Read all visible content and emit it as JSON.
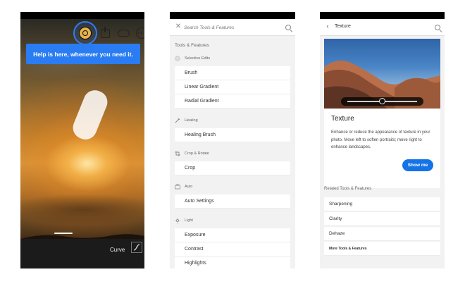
{
  "phone1": {
    "tooltip_text": "Help is here, whenever you need it.",
    "curve_label": "Curve",
    "icons": [
      "help-icon",
      "share-icon",
      "cloud-sync-icon",
      "more-icon",
      "curve-icon"
    ],
    "accent_color": "#2a7cf2"
  },
  "phone2": {
    "search_placeholder": "Search Tools & Features",
    "section_heading": "Tools & Features",
    "categories": [
      {
        "name": "Selective Edits",
        "icon": "selective-edits-icon",
        "items": [
          "Brush",
          "Linear Gradient",
          "Radial Gradient"
        ]
      },
      {
        "name": "Healing",
        "icon": "healing-icon",
        "items": [
          "Healing Brush"
        ]
      },
      {
        "name": "Crop & Rotate",
        "icon": "crop-rotate-icon",
        "items": [
          "Crop"
        ]
      },
      {
        "name": "Auto",
        "icon": "auto-icon",
        "items": [
          "Auto Settings"
        ]
      },
      {
        "name": "Light",
        "icon": "light-icon",
        "items": [
          "Exposure",
          "Contrast",
          "Highlights"
        ]
      }
    ]
  },
  "phone3": {
    "header_title": "Texture",
    "card_title": "Texture",
    "card_description": "Enhance or reduce the appearance of texture in your photo. Move left to soften portraits; move right to enhance landscapes.",
    "show_me_label": "Show me",
    "slider_value": 0.5,
    "related_heading": "Related Tools & Features",
    "related_items": [
      "Sharpening",
      "Clarity",
      "Dehaze"
    ],
    "more_link": "More Tools & Features",
    "button_color": "#1473e6"
  }
}
